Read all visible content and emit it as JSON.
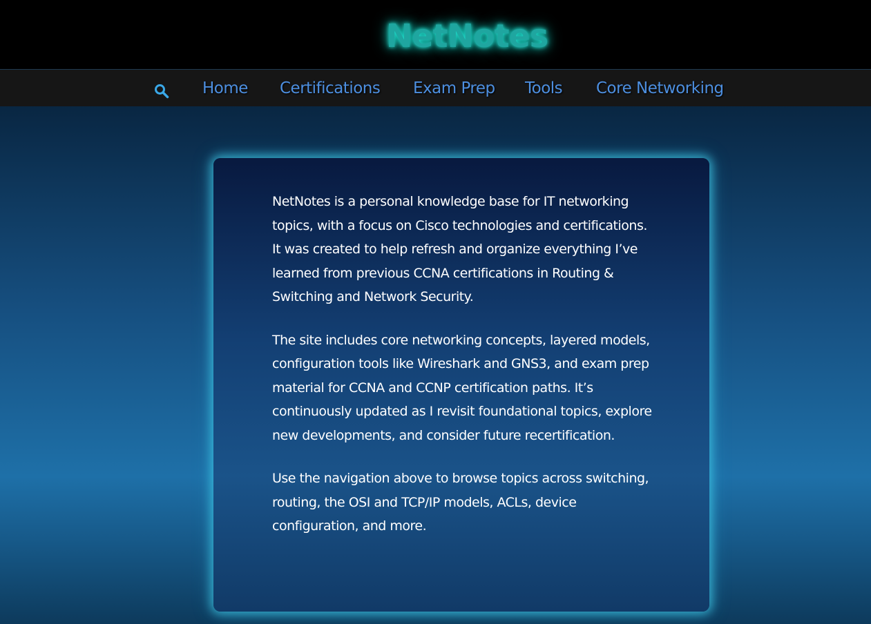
{
  "header": {
    "title": "NetNotes"
  },
  "nav": {
    "search_icon": "search-icon",
    "items": [
      {
        "label": "Home"
      },
      {
        "label": "Certifications"
      },
      {
        "label": "Exam Prep"
      },
      {
        "label": "Tools"
      },
      {
        "label": "Core Networking"
      }
    ]
  },
  "main": {
    "paragraphs": [
      "NetNotes is a personal knowledge base for IT networking topics, with a focus on Cisco technologies and certifications. It was created to help refresh and organize everything I’ve learned from previous CCNA certifications in Routing & Switching and Network Security.",
      "The site includes core networking concepts, layered models, configuration tools like Wireshark and GNS3, and exam prep material for CCNA and CCNP certification paths. It’s continuously updated as I revisit foundational topics, explore new developments, and consider future recertification.",
      "Use the navigation above to browse topics across switching, routing, the OSI and TCP/IP models, ACLs, device configuration, and more."
    ]
  },
  "colors": {
    "title_glow": "#1fa6a0",
    "nav_link": "#4d8fe0",
    "search_icon": "#3aa8e8",
    "card_glow": "#40c8e6"
  }
}
